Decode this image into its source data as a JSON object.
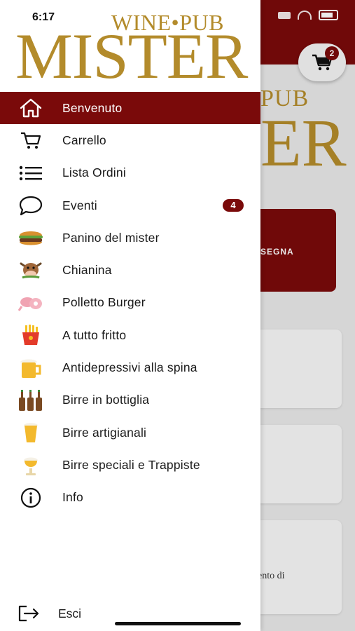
{
  "status": {
    "time": "6:17"
  },
  "logo": {
    "line1": "WINE•PUB",
    "line2": "MISTER"
  },
  "background": {
    "cart_badge": "2",
    "logo_pub": "PUB",
    "logo_er": "ER",
    "card_red_text": "SEGNA",
    "card_text": "ento di"
  },
  "menu": {
    "items": [
      {
        "label": "Benvenuto",
        "icon": "home-icon",
        "active": true
      },
      {
        "label": "Carrello",
        "icon": "cart-icon"
      },
      {
        "label": "Lista Ordini",
        "icon": "list-icon"
      },
      {
        "label": "Eventi",
        "icon": "chat-bubble-icon",
        "badge": "4"
      },
      {
        "label": "Panino del mister",
        "icon": "burger-icon"
      },
      {
        "label": "Chianina",
        "icon": "cow-icon"
      },
      {
        "label": "Polletto Burger",
        "icon": "meat-icon"
      },
      {
        "label": "A tutto fritto",
        "icon": "fries-icon"
      },
      {
        "label": "Antidepressivi alla spina",
        "icon": "beer-mug-icon"
      },
      {
        "label": "Birre in bottiglia",
        "icon": "beer-bottles-icon"
      },
      {
        "label": "Birre artigianali",
        "icon": "craft-beer-icon"
      },
      {
        "label": "Birre speciali e Trappiste",
        "icon": "special-beer-icon"
      },
      {
        "label": "Info",
        "icon": "info-icon"
      }
    ],
    "logout_label": "Esci"
  },
  "colors": {
    "accent": "#7a0a0a",
    "gold": "#b38b2b"
  }
}
